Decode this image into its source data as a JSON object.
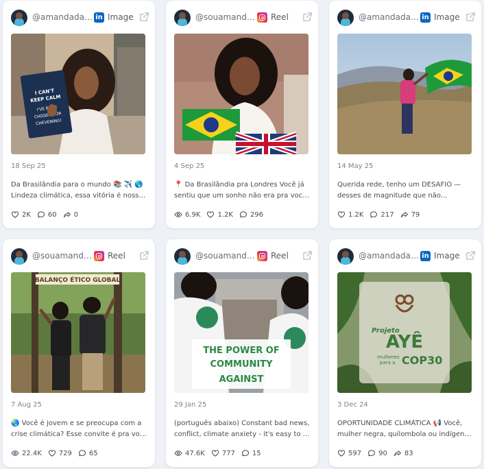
{
  "cards": [
    {
      "handle": "@amandadac...",
      "platform": "linkedin-icon",
      "type": "Image",
      "overlay": [
        "I CAN'T",
        "KEEP CALM",
        "I'VE BEEN",
        "CHOSEN FOR",
        "CHEVENING!"
      ],
      "date": "18 Sep 25",
      "caption": [
        "Da Brasilândia para o mundo 📚 ✈️ 🌎",
        "Lindeza climática, essa vitória é nossa! É..."
      ],
      "stats": [
        {
          "icon": "heart-icon",
          "value": "2K"
        },
        {
          "icon": "comment-icon",
          "value": "60"
        },
        {
          "icon": "share-icon",
          "value": "0"
        }
      ]
    },
    {
      "handle": "@souamandaco...",
      "platform": "instagram-icon",
      "type": "Reel",
      "date": "4 Sep 25",
      "caption": [
        "📍 Da Brasilândia pra Londres Você já",
        "sentiu que um sonho não era pra você?..."
      ],
      "stats": [
        {
          "icon": "eye-icon",
          "value": "6.9K"
        },
        {
          "icon": "heart-icon",
          "value": "1.2K"
        },
        {
          "icon": "comment-icon",
          "value": "296"
        }
      ]
    },
    {
      "handle": "@amandadac...",
      "platform": "linkedin-icon",
      "type": "Image",
      "date": "14 May 25",
      "caption": [
        "Querida rede, tenho um DESAFIO —",
        "desses de magnitude que não..."
      ],
      "stats": [
        {
          "icon": "heart-icon",
          "value": "1.2K"
        },
        {
          "icon": "comment-icon",
          "value": "217"
        },
        {
          "icon": "share-icon",
          "value": "79"
        }
      ]
    },
    {
      "handle": "@souamandaco...",
      "platform": "instagram-icon",
      "type": "Reel",
      "overlay": [
        "BALANÇO ÉTICO GLOBAL"
      ],
      "date": "7 Aug 25",
      "caption": [
        "🌏 Você é jovem e se preocupa com a",
        "crise climática? Esse convite é pra você!..."
      ],
      "stats": [
        {
          "icon": "eye-icon",
          "value": "22.4K"
        },
        {
          "icon": "heart-icon",
          "value": "729"
        },
        {
          "icon": "comment-icon",
          "value": "65"
        }
      ]
    },
    {
      "handle": "@souamandaco...",
      "platform": "instagram-icon",
      "type": "Reel",
      "overlay": [
        "THE POWER OF",
        "COMMUNITY",
        "AGAINST"
      ],
      "date": "29 Jan 25",
      "caption": [
        "(português abaixo) Constant bad news,",
        "conflict, climate anxiety - it's easy to feel..."
      ],
      "stats": [
        {
          "icon": "eye-icon",
          "value": "47.6K"
        },
        {
          "icon": "heart-icon",
          "value": "777"
        },
        {
          "icon": "comment-icon",
          "value": "15"
        }
      ]
    },
    {
      "handle": "@amandadac...",
      "platform": "linkedin-icon",
      "type": "Image",
      "overlay": [
        "Projeto",
        "AYÊ",
        "mulheres",
        "para a",
        "COP30"
      ],
      "date": "3 Dec 24",
      "caption": [
        "OPORTUNIDADE CLIMÁTICA 📢 Você,",
        "mulher negra, quilombola ou indígena,..."
      ],
      "stats": [
        {
          "icon": "heart-icon",
          "value": "597"
        },
        {
          "icon": "comment-icon",
          "value": "90"
        },
        {
          "icon": "share-icon",
          "value": "83"
        }
      ]
    }
  ]
}
